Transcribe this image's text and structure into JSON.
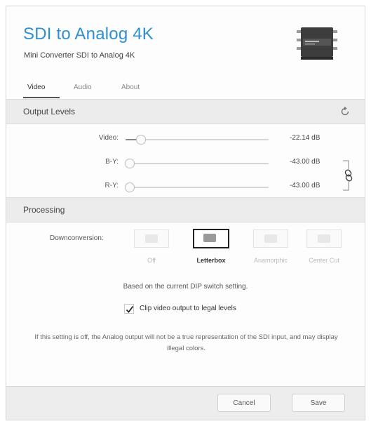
{
  "header": {
    "title": "SDI to Analog 4K",
    "subtitle": "Mini Converter SDI to Analog 4K"
  },
  "tabs": [
    {
      "label": "Video",
      "active": true
    },
    {
      "label": "Audio",
      "active": false
    },
    {
      "label": "About",
      "active": false
    }
  ],
  "output_levels": {
    "title": "Output Levels",
    "sliders": [
      {
        "label": "Video:",
        "value": "-22.14 dB",
        "level_fraction": 0.11
      },
      {
        "label": "B-Y:",
        "value": "-43.00 dB",
        "level_fraction": 0.03
      },
      {
        "label": "R-Y:",
        "value": "-43.00 dB",
        "level_fraction": 0.03
      }
    ]
  },
  "processing": {
    "title": "Processing",
    "downconversion_label": "Downconversion:",
    "options": [
      {
        "label": "Off",
        "selected": false
      },
      {
        "label": "Letterbox",
        "selected": true
      },
      {
        "label": "Anamorphic",
        "selected": false
      },
      {
        "label": "Center Cut",
        "selected": false
      }
    ],
    "dip_note": "Based on the current DIP switch setting.",
    "clip_label": "Clip video output to legal levels",
    "clip_checked": true,
    "warning": "If this setting is off, the Analog output will not be a true representation of the SDI input, and may display illegal colors."
  },
  "footer": {
    "cancel_label": "Cancel",
    "save_label": "Save"
  },
  "colors": {
    "accent": "#2f8fd1"
  }
}
